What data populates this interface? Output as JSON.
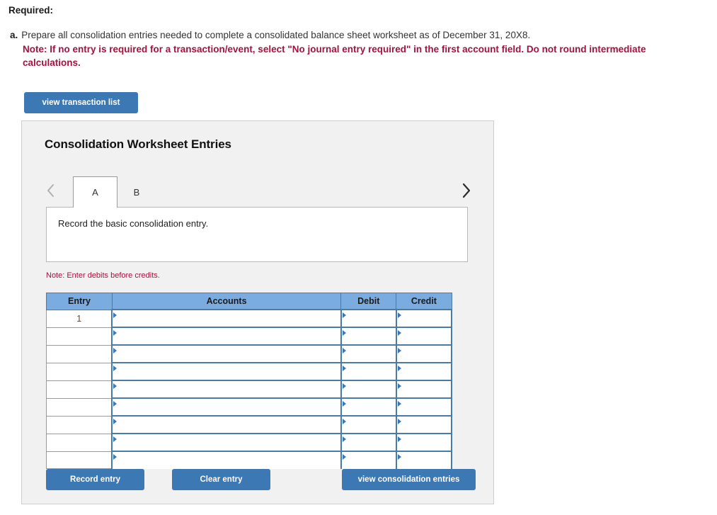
{
  "page": {
    "required_heading": "Required:"
  },
  "question": {
    "letter": "a.",
    "text": "Prepare all consolidation entries needed to complete a consolidated balance sheet worksheet as of December 31, 20X8.",
    "note": "Note: If no entry is required for a transaction/event, select \"No journal entry required\" in the first account field. Do not round intermediate calculations."
  },
  "toolbar": {
    "view_transaction_list_label": "view transaction list"
  },
  "panel": {
    "title": "Consolidation Worksheet Entries",
    "tabs": [
      {
        "label": "A",
        "active": true
      },
      {
        "label": "B",
        "active": false
      }
    ],
    "nav": {
      "prev_icon": "chevron-left-icon",
      "next_icon": "chevron-right-icon"
    },
    "instruction": "Record the basic consolidation entry.",
    "note_small": "Note: Enter debits before credits.",
    "table": {
      "headers": [
        "Entry",
        "Accounts",
        "Debit",
        "Credit"
      ],
      "rows": [
        {
          "entry": "1",
          "accounts": "",
          "debit": "",
          "credit": ""
        },
        {
          "entry": "",
          "accounts": "",
          "debit": "",
          "credit": ""
        },
        {
          "entry": "",
          "accounts": "",
          "debit": "",
          "credit": ""
        },
        {
          "entry": "",
          "accounts": "",
          "debit": "",
          "credit": ""
        },
        {
          "entry": "",
          "accounts": "",
          "debit": "",
          "credit": ""
        },
        {
          "entry": "",
          "accounts": "",
          "debit": "",
          "credit": ""
        },
        {
          "entry": "",
          "accounts": "",
          "debit": "",
          "credit": ""
        },
        {
          "entry": "",
          "accounts": "",
          "debit": "",
          "credit": ""
        },
        {
          "entry": "",
          "accounts": "",
          "debit": "",
          "credit": ""
        }
      ]
    },
    "actions": {
      "record_entry_label": "Record entry",
      "clear_entry_label": "Clear entry",
      "view_consolidation_entries_label": "view consolidation entries"
    }
  },
  "colors": {
    "button_blue": "#3c78b4",
    "table_header_blue": "#7bace0",
    "note_red": "#a4123f",
    "panel_gray": "#f1f1f1"
  }
}
